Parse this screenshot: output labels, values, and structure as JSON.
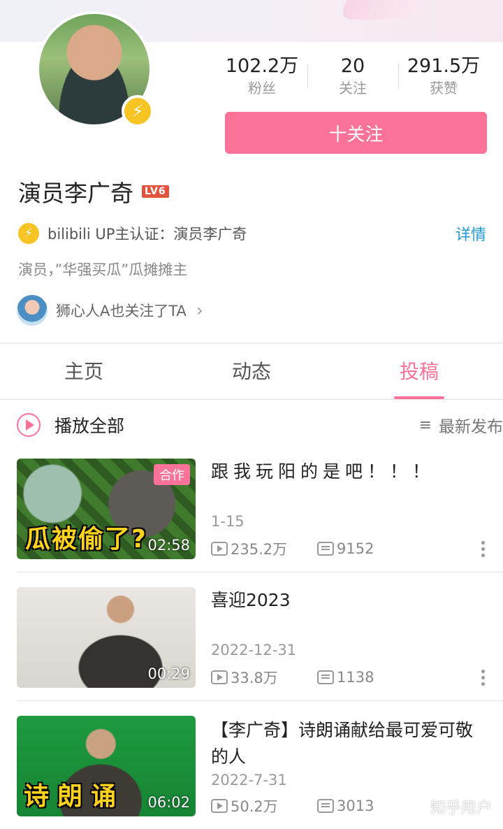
{
  "profile": {
    "name": "演员李广奇",
    "level": "LV6",
    "stats": [
      {
        "value": "102.2万",
        "label": "粉丝"
      },
      {
        "value": "20",
        "label": "关注"
      },
      {
        "value": "291.5万",
        "label": "获赞"
      }
    ],
    "follow_label": "十关注",
    "certification": "bilibili UP主认证：演员李广奇",
    "cert_detail": "详情",
    "bio": "演员，”华强买瓜”瓜摊摊主",
    "mutual": "狮心人A也关注了TA",
    "mutual_chevron": "›"
  },
  "tabs": [
    "主页",
    "动态",
    "投稿"
  ],
  "active_tab": "投稿",
  "toolbar": {
    "play_all": "播放全部",
    "sort_icon": "≡",
    "sort_label": "最新发布"
  },
  "videos": [
    {
      "title": "跟我玩阳的是吧！！！",
      "date": "1-15",
      "views": "235.2万",
      "danmaku": "9152",
      "duration": "02:58",
      "tag": "合作",
      "thumb_caption": "瓜被偷了?"
    },
    {
      "title": "喜迎2023",
      "date": "2022-12-31",
      "views": "33.8万",
      "danmaku": "1138",
      "duration": "00:29"
    },
    {
      "title": "【李广奇】诗朗诵献给最可爱可敬的人",
      "date": "2022-7-31",
      "views": "50.2万",
      "danmaku": "3013",
      "duration": "06:02",
      "thumb_caption": "诗朗诵"
    }
  ],
  "watermark": "知乎用户",
  "colors": {
    "accent": "#fb7299",
    "link": "#1e9ad6",
    "badge": "#f6c423"
  }
}
